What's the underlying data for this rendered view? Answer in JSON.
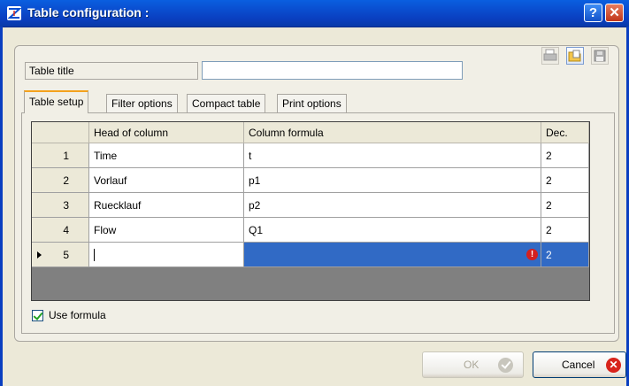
{
  "window": {
    "title": "Table configuration :",
    "help_button": "?",
    "close_button": "✕"
  },
  "toolbar": {
    "icons": [
      "print-icon",
      "open-folder-icon",
      "save-icon"
    ]
  },
  "table_title": {
    "label": "Table title",
    "value": ""
  },
  "tabs": [
    {
      "label": "Table setup",
      "active": true
    },
    {
      "label": "Filter options",
      "active": false
    },
    {
      "label": "Compact table",
      "active": false
    },
    {
      "label": "Print options",
      "active": false
    }
  ],
  "grid": {
    "columns": [
      "",
      "Head of column",
      "Column formula",
      "Dec."
    ],
    "rows": [
      {
        "num": "1",
        "head": "Time",
        "formula": "t",
        "dec": "2"
      },
      {
        "num": "2",
        "head": "Vorlauf",
        "formula": "p1",
        "dec": "2"
      },
      {
        "num": "3",
        "head": "Ruecklauf",
        "formula": "p2",
        "dec": "2"
      },
      {
        "num": "4",
        "head": "Flow",
        "formula": "Q1",
        "dec": "2"
      },
      {
        "num": "5",
        "head": "",
        "formula": "",
        "dec": "2"
      }
    ],
    "error_glyph": "!"
  },
  "use_formula": {
    "label": "Use formula",
    "checked": true
  },
  "buttons": {
    "ok": "OK",
    "cancel": "Cancel",
    "cancel_glyph": "✕"
  }
}
